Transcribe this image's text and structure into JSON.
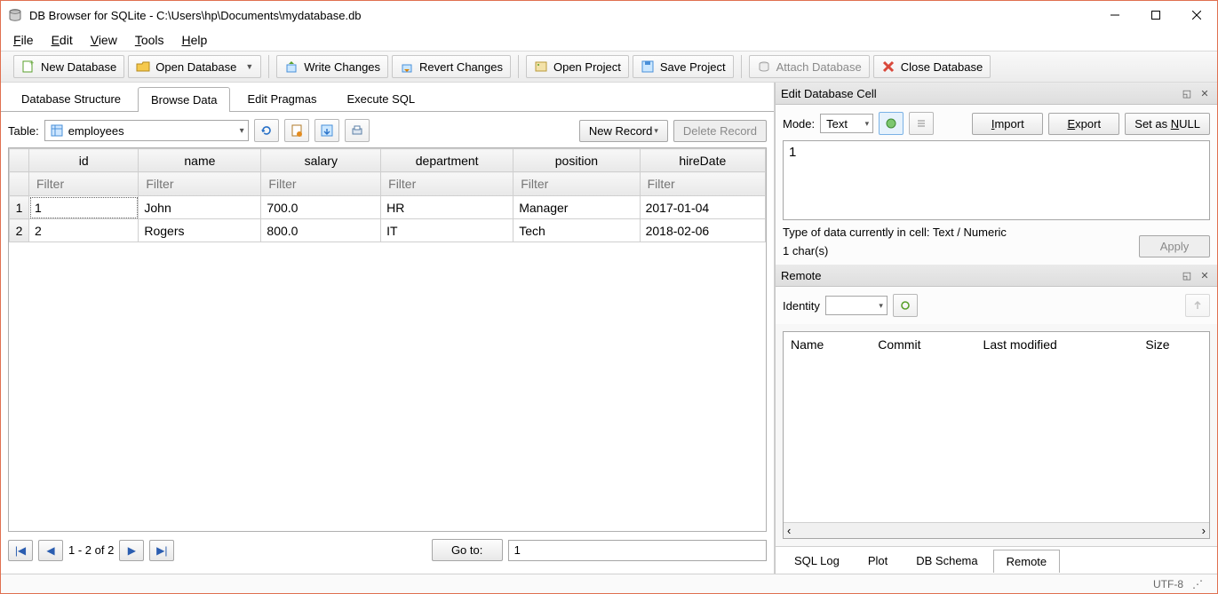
{
  "title": "DB Browser for SQLite - C:\\Users\\hp\\Documents\\mydatabase.db",
  "menu": {
    "file": "File",
    "edit": "Edit",
    "view": "View",
    "tools": "Tools",
    "help": "Help"
  },
  "toolbar": {
    "new_db": "New Database",
    "open_db": "Open Database",
    "write_changes": "Write Changes",
    "revert_changes": "Revert Changes",
    "open_project": "Open Project",
    "save_project": "Save Project",
    "attach_db": "Attach Database",
    "close_db": "Close Database"
  },
  "tabs": {
    "db_structure": "Database Structure",
    "browse_data": "Browse Data",
    "edit_pragmas": "Edit Pragmas",
    "execute_sql": "Execute SQL"
  },
  "browse": {
    "table_label": "Table:",
    "selected_table": "employees",
    "new_record": "New Record",
    "delete_record": "Delete Record",
    "filter_placeholder": "Filter",
    "columns": [
      "id",
      "name",
      "salary",
      "department",
      "position",
      "hireDate"
    ],
    "rows": [
      {
        "rownum": "1",
        "id": "1",
        "name": "John",
        "salary": "700.0",
        "department": "HR",
        "position": "Manager",
        "hireDate": "2017-01-04"
      },
      {
        "rownum": "2",
        "id": "2",
        "name": "Rogers",
        "salary": "800.0",
        "department": "IT",
        "position": "Tech",
        "hireDate": "2018-02-06"
      }
    ]
  },
  "pager": {
    "range": "1 - 2 of 2",
    "goto_label": "Go to:",
    "goto_value": "1"
  },
  "editcell": {
    "header": "Edit Database Cell",
    "mode_label": "Mode:",
    "mode_value": "Text",
    "import": "Import",
    "export": "Export",
    "set_null": "Set as NULL",
    "value": "1",
    "type_label": "Type of data currently in cell: Text / Numeric",
    "chars": "1 char(s)",
    "apply": "Apply"
  },
  "remote": {
    "header": "Remote",
    "identity_label": "Identity",
    "cols": [
      "Name",
      "Commit",
      "Last modified",
      "Size"
    ]
  },
  "dock_tabs": {
    "sql_log": "SQL Log",
    "plot": "Plot",
    "db_schema": "DB Schema",
    "remote": "Remote"
  },
  "status": {
    "encoding": "UTF-8"
  }
}
